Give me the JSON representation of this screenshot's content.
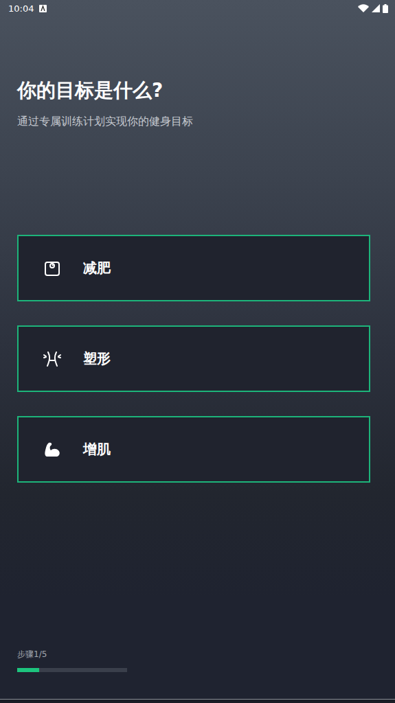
{
  "status_bar": {
    "time": "10:04"
  },
  "header": {
    "title": "你的目标是什么?",
    "subtitle": "通过专属训练计划实现你的健身目标"
  },
  "goals": [
    {
      "label": "减肥",
      "selected": false
    },
    {
      "label": "塑形",
      "selected": false
    },
    {
      "label": "增肌",
      "selected": false
    }
  ],
  "progress": {
    "label": "步骤1/5",
    "level": 0.2
  }
}
